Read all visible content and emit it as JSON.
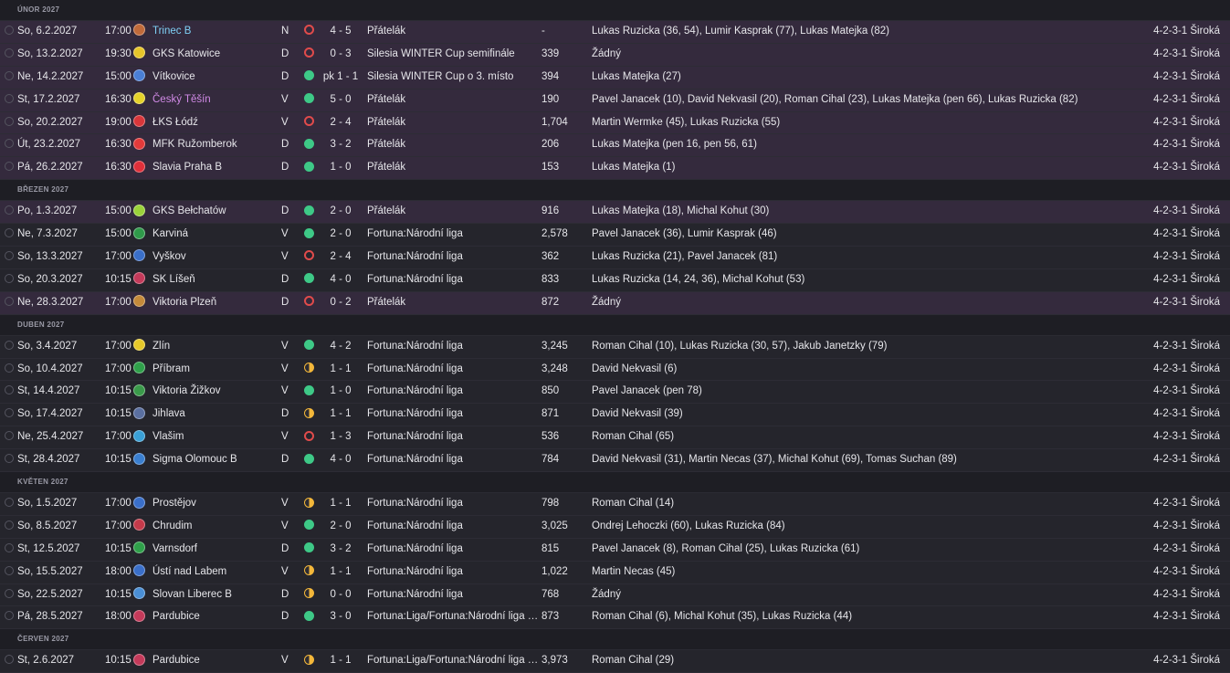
{
  "months": [
    {
      "label": "ÚNOR 2027",
      "matches": [
        {
          "date": "So, 6.2.2027",
          "time": "17:00",
          "opponent": "Trinec B",
          "opp_style": "ext",
          "crest": "#c06a3a",
          "venue": "N",
          "result": "L",
          "score": "4 - 5",
          "competition": "Přátelák",
          "type": "friendly",
          "attendance": "-",
          "scorers": "Lukas Ruzicka (36, 54), Lumir Kasprak (77), Lukas Matejka (82)",
          "formation": "4-2-3-1 Široká"
        },
        {
          "date": "So, 13.2.2027",
          "time": "19:30",
          "opponent": "GKS Katowice",
          "opp_style": "",
          "crest": "#e7c62a",
          "venue": "D",
          "result": "L",
          "score": "0 - 3",
          "competition": "Silesia WINTER Cup semifinále",
          "type": "friendly",
          "attendance": "339",
          "scorers": "Žádný",
          "formation": "4-2-3-1 Široká"
        },
        {
          "date": "Ne, 14.2.2027",
          "time": "15:00",
          "opponent": "Vítkovice",
          "opp_style": "",
          "crest": "#4a7fd6",
          "venue": "D",
          "result": "W",
          "score": "pk 1 - 1",
          "competition": "Silesia WINTER Cup o 3. místo",
          "type": "friendly",
          "attendance": "394",
          "scorers": "Lukas Matejka (27)",
          "formation": "4-2-3-1 Široká"
        },
        {
          "date": "St, 17.2.2027",
          "time": "16:30",
          "opponent": "Český Těšín",
          "opp_style": "purple",
          "crest": "#e5d22a",
          "venue": "V",
          "result": "W",
          "score": "5 - 0",
          "competition": "Přátelák",
          "type": "friendly",
          "attendance": "190",
          "scorers": "Pavel Janacek (10), David Nekvasil (20), Roman Cihal (23), Lukas Matejka (pen 66), Lukas Ruzicka (82)",
          "formation": "4-2-3-1 Široká"
        },
        {
          "date": "So, 20.2.2027",
          "time": "19:00",
          "opponent": "ŁKS Łódź",
          "opp_style": "",
          "crest": "#d9363a",
          "venue": "V",
          "result": "L",
          "score": "2 - 4",
          "competition": "Přátelák",
          "type": "friendly",
          "attendance": "1,704",
          "scorers": "Martin Wermke (45), Lukas Ruzicka (55)",
          "formation": "4-2-3-1 Široká"
        },
        {
          "date": "Út, 23.2.2027",
          "time": "16:30",
          "opponent": "MFK Ružomberok",
          "opp_style": "",
          "crest": "#e23a3a",
          "venue": "D",
          "result": "W",
          "score": "3 - 2",
          "competition": "Přátelák",
          "type": "friendly",
          "attendance": "206",
          "scorers": "Lukas Matejka (pen 16, pen 56, 61)",
          "formation": "4-2-3-1 Široká"
        },
        {
          "date": "Pá, 26.2.2027",
          "time": "16:30",
          "opponent": "Slavia Praha B",
          "opp_style": "",
          "crest": "#e0303a",
          "venue": "D",
          "result": "W",
          "score": "1 - 0",
          "competition": "Přátelák",
          "type": "friendly",
          "attendance": "153",
          "scorers": "Lukas Matejka (1)",
          "formation": "4-2-3-1 Široká"
        }
      ]
    },
    {
      "label": "BŘEZEN 2027",
      "matches": [
        {
          "date": "Po, 1.3.2027",
          "time": "15:00",
          "opponent": "GKS Bełchatów",
          "opp_style": "",
          "crest": "#9ad23a",
          "venue": "D",
          "result": "W",
          "score": "2 - 0",
          "competition": "Přátelák",
          "type": "friendly",
          "attendance": "916",
          "scorers": "Lukas Matejka (18), Michal Kohut (30)",
          "formation": "4-2-3-1 Široká"
        },
        {
          "date": "Ne, 7.3.2027",
          "time": "15:00",
          "opponent": "Karviná",
          "opp_style": "",
          "crest": "#2f9a4a",
          "venue": "V",
          "result": "W",
          "score": "2 - 0",
          "competition": "Fortuna:Národní liga",
          "type": "league",
          "attendance": "2,578",
          "scorers": "Pavel Janacek (36), Lumir Kasprak (46)",
          "formation": "4-2-3-1 Široká"
        },
        {
          "date": "So, 13.3.2027",
          "time": "17:00",
          "opponent": "Vyškov",
          "opp_style": "",
          "crest": "#3a6fc9",
          "venue": "V",
          "result": "L",
          "score": "2 - 4",
          "competition": "Fortuna:Národní liga",
          "type": "league",
          "attendance": "362",
          "scorers": "Lukas Ruzicka (21), Pavel Janacek (81)",
          "formation": "4-2-3-1 Široká"
        },
        {
          "date": "So, 20.3.2027",
          "time": "10:15",
          "opponent": "SK Líšeň",
          "opp_style": "",
          "crest": "#c43a5a",
          "venue": "D",
          "result": "W",
          "score": "4 - 0",
          "competition": "Fortuna:Národní liga",
          "type": "league",
          "attendance": "833",
          "scorers": "Lukas Ruzicka (14, 24, 36), Michal Kohut (53)",
          "formation": "4-2-3-1 Široká"
        },
        {
          "date": "Ne, 28.3.2027",
          "time": "17:00",
          "opponent": "Viktoria Plzeň",
          "opp_style": "",
          "crest": "#c48a3a",
          "venue": "D",
          "result": "L",
          "score": "0 - 2",
          "competition": "Přátelák",
          "type": "friendly",
          "attendance": "872",
          "scorers": "Žádný",
          "formation": "4-2-3-1 Široká"
        }
      ]
    },
    {
      "label": "DUBEN 2027",
      "matches": [
        {
          "date": "So, 3.4.2027",
          "time": "17:00",
          "opponent": "Zlín",
          "opp_style": "",
          "crest": "#e5c82a",
          "venue": "V",
          "result": "W",
          "score": "4 - 2",
          "competition": "Fortuna:Národní liga",
          "type": "league",
          "attendance": "3,245",
          "scorers": "Roman Cihal (10), Lukas Ruzicka (30, 57), Jakub Janetzky (79)",
          "formation": "4-2-3-1 Široká"
        },
        {
          "date": "So, 10.4.2027",
          "time": "17:00",
          "opponent": "Příbram",
          "opp_style": "",
          "crest": "#2fa04a",
          "venue": "V",
          "result": "D",
          "score": "1 - 1",
          "competition": "Fortuna:Národní liga",
          "type": "league",
          "attendance": "3,248",
          "scorers": "David Nekvasil (6)",
          "formation": "4-2-3-1 Široká"
        },
        {
          "date": "St, 14.4.2027",
          "time": "10:15",
          "opponent": "Viktoria Žižkov",
          "opp_style": "",
          "crest": "#3a9a4a",
          "venue": "V",
          "result": "W",
          "score": "1 - 0",
          "competition": "Fortuna:Národní liga",
          "type": "league",
          "attendance": "850",
          "scorers": "Pavel Janacek (pen 78)",
          "formation": "4-2-3-1 Široká"
        },
        {
          "date": "So, 17.4.2027",
          "time": "10:15",
          "opponent": "Jihlava",
          "opp_style": "",
          "crest": "#5a6fa0",
          "venue": "D",
          "result": "D",
          "score": "1 - 1",
          "competition": "Fortuna:Národní liga",
          "type": "league",
          "attendance": "871",
          "scorers": "David Nekvasil (39)",
          "formation": "4-2-3-1 Široká"
        },
        {
          "date": "Ne, 25.4.2027",
          "time": "17:00",
          "opponent": "Vlašim",
          "opp_style": "",
          "crest": "#3aa0d6",
          "venue": "V",
          "result": "L",
          "score": "1 - 3",
          "competition": "Fortuna:Národní liga",
          "type": "league",
          "attendance": "536",
          "scorers": "Roman Cihal (65)",
          "formation": "4-2-3-1 Široká"
        },
        {
          "date": "St, 28.4.2027",
          "time": "10:15",
          "opponent": "Sigma Olomouc B",
          "opp_style": "",
          "crest": "#3a7fd0",
          "venue": "D",
          "result": "W",
          "score": "4 - 0",
          "competition": "Fortuna:Národní liga",
          "type": "league",
          "attendance": "784",
          "scorers": "David Nekvasil (31), Martin Necas (37), Michal Kohut (69), Tomas Suchan (89)",
          "formation": "4-2-3-1 Široká"
        }
      ]
    },
    {
      "label": "KVĚTEN 2027",
      "matches": [
        {
          "date": "So, 1.5.2027",
          "time": "17:00",
          "opponent": "Prostějov",
          "opp_style": "",
          "crest": "#3a6fc9",
          "venue": "V",
          "result": "D",
          "score": "1 - 1",
          "competition": "Fortuna:Národní liga",
          "type": "league",
          "attendance": "798",
          "scorers": "Roman Cihal (14)",
          "formation": "4-2-3-1 Široká"
        },
        {
          "date": "So, 8.5.2027",
          "time": "17:00",
          "opponent": "Chrudim",
          "opp_style": "",
          "crest": "#c43a4a",
          "venue": "V",
          "result": "W",
          "score": "2 - 0",
          "competition": "Fortuna:Národní liga",
          "type": "league",
          "attendance": "3,025",
          "scorers": "Ondrej Lehoczki (60), Lukas Ruzicka (84)",
          "formation": "4-2-3-1 Široká"
        },
        {
          "date": "St, 12.5.2027",
          "time": "10:15",
          "opponent": "Varnsdorf",
          "opp_style": "",
          "crest": "#2fa04a",
          "venue": "D",
          "result": "W",
          "score": "3 - 2",
          "competition": "Fortuna:Národní liga",
          "type": "league",
          "attendance": "815",
          "scorers": "Pavel Janacek (8), Roman Cihal (25), Lukas Ruzicka (61)",
          "formation": "4-2-3-1 Široká"
        },
        {
          "date": "So, 15.5.2027",
          "time": "18:00",
          "opponent": "Ústí nad Labem",
          "opp_style": "",
          "crest": "#3a6fc9",
          "venue": "V",
          "result": "D",
          "score": "1 - 1",
          "competition": "Fortuna:Národní liga",
          "type": "league",
          "attendance": "1,022",
          "scorers": "Martin Necas (45)",
          "formation": "4-2-3-1 Široká"
        },
        {
          "date": "So, 22.5.2027",
          "time": "10:15",
          "opponent": "Slovan Liberec B",
          "opp_style": "",
          "crest": "#4a8fd6",
          "venue": "D",
          "result": "D",
          "score": "0 - 0",
          "competition": "Fortuna:Národní liga",
          "type": "league",
          "attendance": "768",
          "scorers": "Žádný",
          "formation": "4-2-3-1 Široká"
        },
        {
          "date": "Pá, 28.5.2027",
          "time": "18:00",
          "opponent": "Pardubice",
          "opp_style": "",
          "crest": "#c43a5a",
          "venue": "D",
          "result": "W",
          "score": "3 - 0",
          "competition": "Fortuna:Liga/Fortuna:Národní liga Play-off",
          "type": "league",
          "attendance": "873",
          "scorers": "Roman Cihal (6), Michal Kohut (35), Lukas Ruzicka (44)",
          "formation": "4-2-3-1 Široká"
        }
      ]
    },
    {
      "label": "ČERVEN 2027",
      "matches": [
        {
          "date": "St, 2.6.2027",
          "time": "10:15",
          "opponent": "Pardubice",
          "opp_style": "",
          "crest": "#c43a5a",
          "venue": "V",
          "result": "D",
          "score": "1 - 1",
          "competition": "Fortuna:Liga/Fortuna:Národní liga Play-off",
          "type": "league",
          "attendance": "3,973",
          "scorers": "Roman Cihal (29)",
          "formation": "4-2-3-1 Široká"
        }
      ]
    }
  ]
}
